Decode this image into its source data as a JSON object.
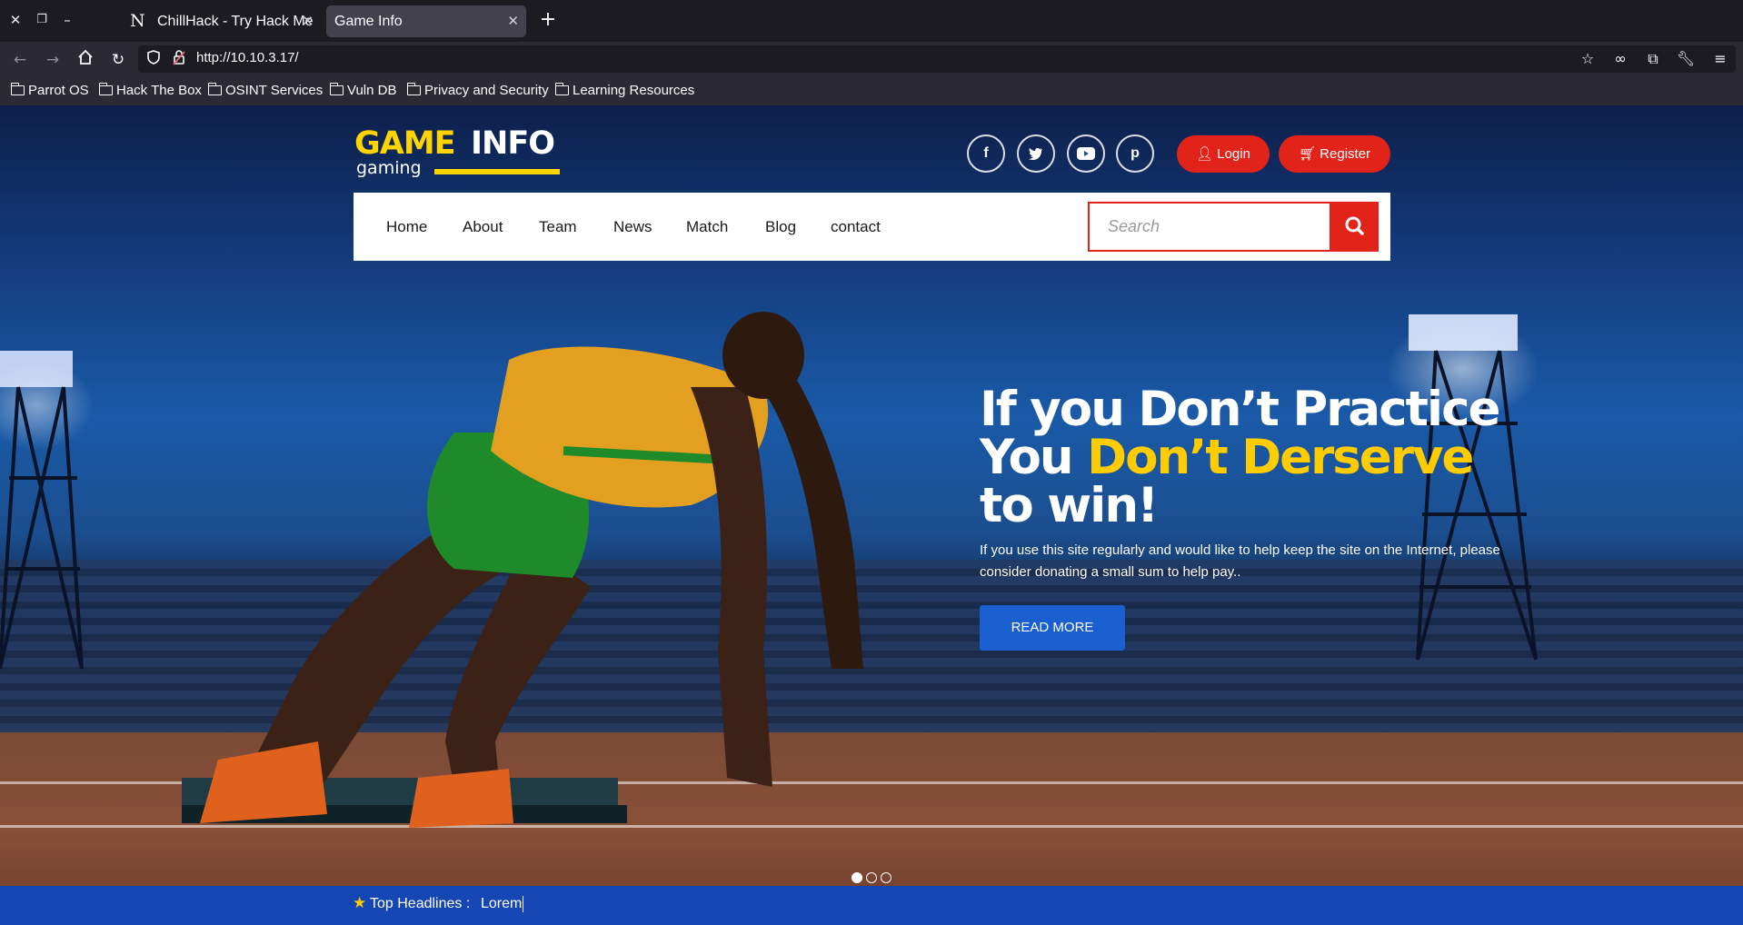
{
  "browser": {
    "tabs": [
      {
        "title": "ChillHack - Try Hack Me |",
        "icon": "n-logo-icon"
      },
      {
        "title": "Game Info",
        "icon": ""
      }
    ],
    "url_host": "http://10.10.3.17/",
    "bookmarks": [
      "Parrot OS",
      "Hack The Box",
      "OSINT Services",
      "Vuln DB",
      "Privacy and Security",
      "Learning Resources"
    ]
  },
  "site": {
    "logo": {
      "game": "GAME",
      "info": "INFO",
      "sub": "gaming"
    },
    "social": [
      "f",
      "t",
      "y",
      "p"
    ],
    "login_label": "Login",
    "register_label": "Register",
    "menu": [
      "Home",
      "About",
      "Team",
      "News",
      "Match",
      "Blog",
      "contact"
    ],
    "search_placeholder": "Search",
    "hero": {
      "line1": "If you Don’t Practice",
      "line2_white": "You ",
      "line2_yellow": "Don’t Derserve",
      "line3": "to win!",
      "description": "If you use this site regularly and would like to help keep the site on the Internet, please consider donating a small sum to help pay..",
      "button": "READ MORE"
    },
    "headlines_label": "Top Headlines :",
    "headlines_text": "Lorem"
  },
  "colors": {
    "brand_yellow": "#ffd400",
    "brand_red": "#e2231a",
    "brand_blue": "#1646b3",
    "button_blue": "#1a5fd0"
  }
}
